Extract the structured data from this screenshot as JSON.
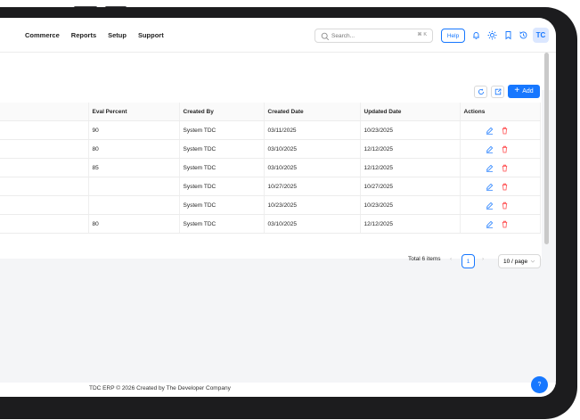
{
  "nav": {
    "items": [
      "Commerce",
      "Reports",
      "Setup",
      "Support"
    ]
  },
  "search": {
    "placeholder": "Search...",
    "shortcut": "⌘ K"
  },
  "header": {
    "help_label": "Help",
    "avatar_initials": "TC"
  },
  "toolbar": {
    "add_label": "Add"
  },
  "table": {
    "columns": [
      "Eval Percent",
      "Created By",
      "Created Date",
      "Updated Date",
      "Actions"
    ],
    "rows": [
      {
        "eval": "90",
        "created_by": "System TDC",
        "created_date": "03/11/2025",
        "updated_date": "10/23/2025"
      },
      {
        "eval": "80",
        "created_by": "System TDC",
        "created_date": "03/10/2025",
        "updated_date": "12/12/2025"
      },
      {
        "eval": "85",
        "created_by": "System TDC",
        "created_date": "03/10/2025",
        "updated_date": "12/12/2025"
      },
      {
        "eval": "",
        "created_by": "System TDC",
        "created_date": "10/27/2025",
        "updated_date": "10/27/2025"
      },
      {
        "eval": "",
        "created_by": "System TDC",
        "created_date": "10/23/2025",
        "updated_date": "10/23/2025"
      },
      {
        "eval": "80",
        "created_by": "System TDC",
        "created_date": "03/10/2025",
        "updated_date": "12/12/2025"
      }
    ]
  },
  "pagination": {
    "total": "Total 6 items",
    "current_page": "1",
    "page_size": "10 / page"
  },
  "footer": {
    "text": "TDC ERP © 2026 Created by The Developer Company"
  },
  "help_fab": {
    "label": "?"
  },
  "colors": {
    "primary": "#1677ff",
    "danger": "#ff4d4f",
    "avatar_bg": "#dbe7ff"
  }
}
